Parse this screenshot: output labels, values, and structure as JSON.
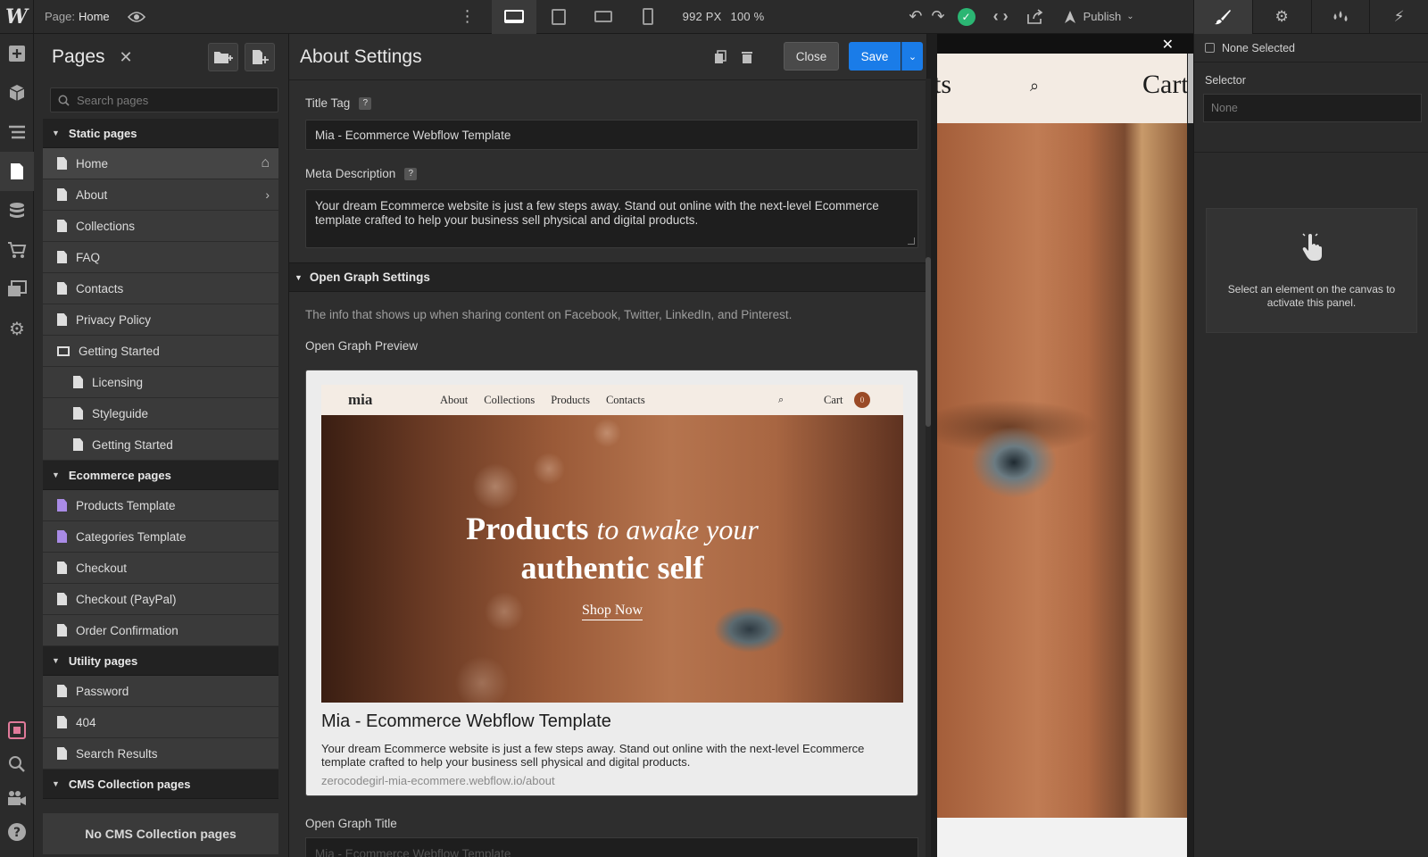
{
  "topbar": {
    "logo": "W",
    "page_prefix": "Page:",
    "page_name": "Home",
    "viewport_width": "992 PX",
    "zoom": "100 %",
    "publish_label": "Publish"
  },
  "pages_panel": {
    "title": "Pages",
    "search_placeholder": "Search pages",
    "sections": {
      "static": "Static pages",
      "ecommerce": "Ecommerce pages",
      "utility": "Utility pages",
      "cms": "CMS Collection pages"
    },
    "static_items": [
      "Home",
      "About",
      "Collections",
      "FAQ",
      "Contacts",
      "Privacy Policy"
    ],
    "folder": "Getting Started",
    "folder_items": [
      "Licensing",
      "Styleguide",
      "Getting Started"
    ],
    "ecommerce_items": [
      "Products Template",
      "Categories Template",
      "Checkout",
      "Checkout (PayPal)",
      "Order Confirmation"
    ],
    "utility_items": [
      "Password",
      "404",
      "Search Results"
    ],
    "no_cms": "No CMS Collection pages"
  },
  "settings": {
    "title": "About Settings",
    "close_label": "Close",
    "save_label": "Save",
    "title_tag_label": "Title Tag",
    "title_tag_value": "Mia - Ecommerce Webflow Template",
    "meta_label": "Meta Description",
    "meta_value": "Your dream Ecommerce website is just a few steps away. Stand out online with the next-level Ecommerce template crafted to help your business sell physical and digital products.",
    "og_section": "Open Graph Settings",
    "og_info": "The info that shows up when sharing content on Facebook, Twitter, LinkedIn, and Pinterest.",
    "og_preview_label": "Open Graph Preview",
    "og_title_label": "Open Graph Title",
    "og_title_placeholder": "Mia - Ecommerce Webflow Template",
    "preview": {
      "logo": "mia",
      "links": [
        "About",
        "Collections",
        "Products",
        "Contacts"
      ],
      "cart": "Cart",
      "cart_count": "0",
      "hero_bold": "Products",
      "hero_italic": "to awake your",
      "hero_line2": "authentic self",
      "hero_cta": "Shop Now",
      "title": "Mia - Ecommerce Webflow Template",
      "description": "Your dream Ecommerce website is just a few steps away. Stand out online with the next-level Ecommerce template crafted to help your business sell physical and digital products.",
      "url": "zerocodegirl-mia-ecommere.webflow.io/about"
    }
  },
  "canvas": {
    "nav_text": "ts",
    "cart_text": "Cart"
  },
  "right_panel": {
    "none_selected": "None Selected",
    "selector_label": "Selector",
    "selector_placeholder": "None",
    "empty_msg": "Select an element on the canvas to activate this panel."
  }
}
